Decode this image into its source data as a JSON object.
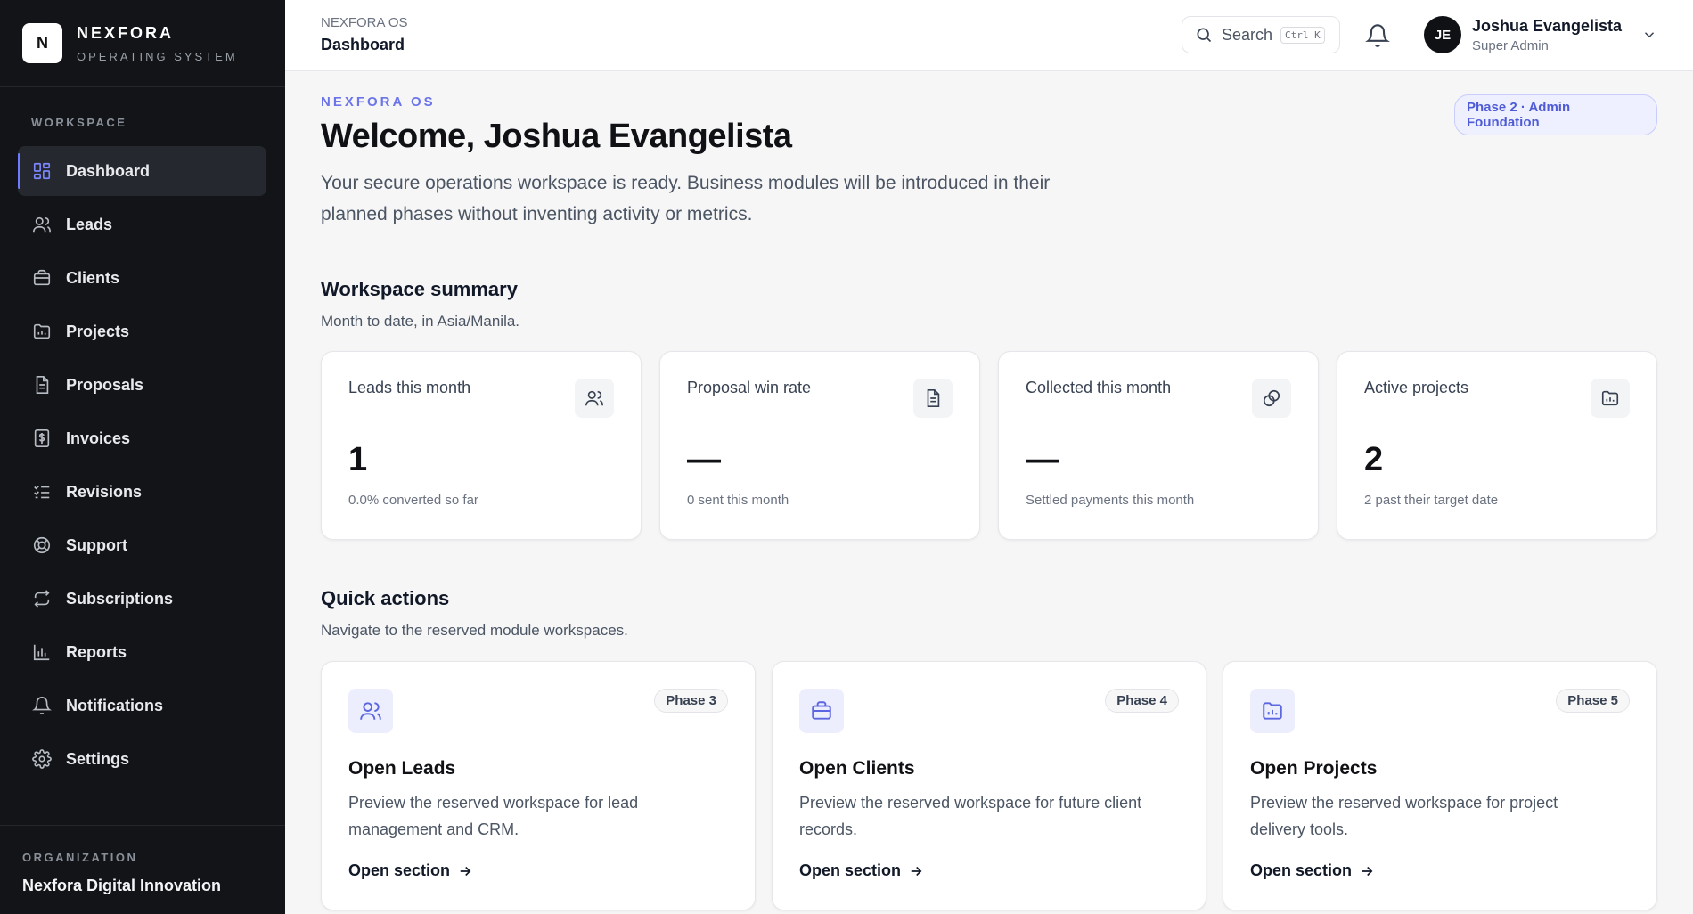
{
  "brand": {
    "logo_letter": "N",
    "name": "NEXFORA",
    "subtitle": "OPERATING SYSTEM"
  },
  "sidebar": {
    "section_label": "WORKSPACE",
    "items": [
      {
        "label": "Dashboard",
        "icon": "dashboard-icon",
        "active": true
      },
      {
        "label": "Leads",
        "icon": "users-icon"
      },
      {
        "label": "Clients",
        "icon": "briefcase-icon"
      },
      {
        "label": "Projects",
        "icon": "folder-icon"
      },
      {
        "label": "Proposals",
        "icon": "document-icon"
      },
      {
        "label": "Invoices",
        "icon": "dollar-file-icon"
      },
      {
        "label": "Revisions",
        "icon": "checklist-icon"
      },
      {
        "label": "Support",
        "icon": "lifebuoy-icon"
      },
      {
        "label": "Subscriptions",
        "icon": "repeat-icon"
      },
      {
        "label": "Reports",
        "icon": "bar-chart-icon"
      },
      {
        "label": "Notifications",
        "icon": "bell-icon"
      },
      {
        "label": "Settings",
        "icon": "gear-icon"
      }
    ],
    "org_label": "ORGANIZATION",
    "org_name": "Nexfora Digital Innovation"
  },
  "header": {
    "crumb_top": "NEXFORA OS",
    "page_title": "Dashboard",
    "search_label": "Search",
    "search_shortcut": "Ctrl K",
    "user_initials": "JE",
    "user_name": "Joshua Evangelista",
    "user_role": "Super Admin"
  },
  "hero": {
    "eyebrow": "NEXFORA OS",
    "phase_badge": "Phase 2 · Admin Foundation",
    "title": "Welcome, Joshua Evangelista",
    "intro": "Your secure operations workspace is ready. Business modules will be introduced in their planned phases without inventing activity or metrics."
  },
  "summary": {
    "title": "Workspace summary",
    "subtitle": "Month to date, in Asia/Manila.",
    "cards": [
      {
        "label": "Leads this month",
        "value": "1",
        "note": "0.0% converted so far",
        "icon": "users-icon"
      },
      {
        "label": "Proposal win rate",
        "value": "—",
        "note": "0 sent this month",
        "icon": "document-icon"
      },
      {
        "label": "Collected this month",
        "value": "—",
        "note": "Settled payments this month",
        "icon": "coins-icon"
      },
      {
        "label": "Active projects",
        "value": "2",
        "note": "2 past their target date",
        "icon": "folder-icon"
      }
    ]
  },
  "quick_actions": {
    "title": "Quick actions",
    "subtitle": "Navigate to the reserved module workspaces.",
    "cards": [
      {
        "phase": "Phase 3",
        "title": "Open Leads",
        "desc": "Preview the reserved workspace for lead management and CRM.",
        "link": "Open section",
        "icon": "users-icon"
      },
      {
        "phase": "Phase 4",
        "title": "Open Clients",
        "desc": "Preview the reserved workspace for future client records.",
        "link": "Open section",
        "icon": "briefcase-icon"
      },
      {
        "phase": "Phase 5",
        "title": "Open Projects",
        "desc": "Preview the reserved workspace for project delivery tools.",
        "link": "Open section",
        "icon": "folder-icon"
      }
    ]
  },
  "colors": {
    "accent": "#6c7bff",
    "sidebar_bg": "#121417",
    "page_bg": "#f6f6f7"
  }
}
